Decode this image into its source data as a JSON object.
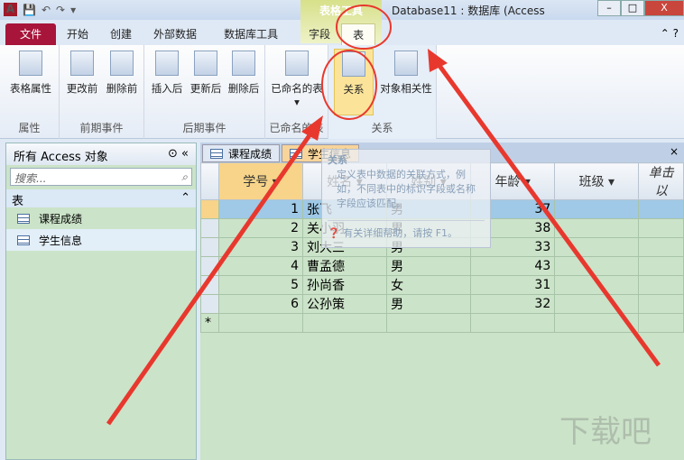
{
  "window": {
    "title": "Database11 : 数据库 (Access",
    "context_tab": "表格工具",
    "app_icon": "A"
  },
  "ribbon_tabs": [
    "文件",
    "开始",
    "创建",
    "外部数据",
    "数据库工具",
    "字段",
    "表"
  ],
  "groups": [
    {
      "label": "属性",
      "buttons": [
        "表格属性"
      ]
    },
    {
      "label": "前期事件",
      "buttons": [
        "更改前",
        "删除前"
      ]
    },
    {
      "label": "后期事件",
      "buttons": [
        "插入后",
        "更新后",
        "删除后"
      ]
    },
    {
      "label": "已命名的表",
      "buttons": [
        "已命名的表"
      ]
    },
    {
      "label": "关系",
      "buttons": [
        "关系",
        "对象相关性"
      ]
    }
  ],
  "nav": {
    "title": "所有 Access 对象",
    "search_placeholder": "搜索...",
    "section": "表",
    "items": [
      "课程成绩",
      "学生信息"
    ]
  },
  "doc_tabs": [
    "课程成绩",
    "学生信息"
  ],
  "table": {
    "columns": [
      "学号",
      "姓名",
      "姓别",
      "年龄",
      "班级",
      "单击以"
    ],
    "rows": [
      [
        "1",
        "张飞",
        "男",
        "37"
      ],
      [
        "2",
        "关小羽",
        "男",
        "38"
      ],
      [
        "3",
        "刘大三",
        "男",
        "33"
      ],
      [
        "4",
        "曹孟德",
        "男",
        "43"
      ],
      [
        "5",
        "孙尚香",
        "女",
        "31"
      ],
      [
        "6",
        "公孙策",
        "男",
        "32"
      ]
    ],
    "new_row_marker": "*"
  },
  "tooltip": {
    "title": "关系",
    "body": "定义表中数据的关联方式，例如，不同表中的标识字段或名称字段应该匹配。",
    "help": "有关详细帮助，请按 F1。"
  },
  "colors": {
    "file_tab": "#a8153a",
    "annotation": "#e8382e",
    "datasheet": "#cbe3c8"
  }
}
